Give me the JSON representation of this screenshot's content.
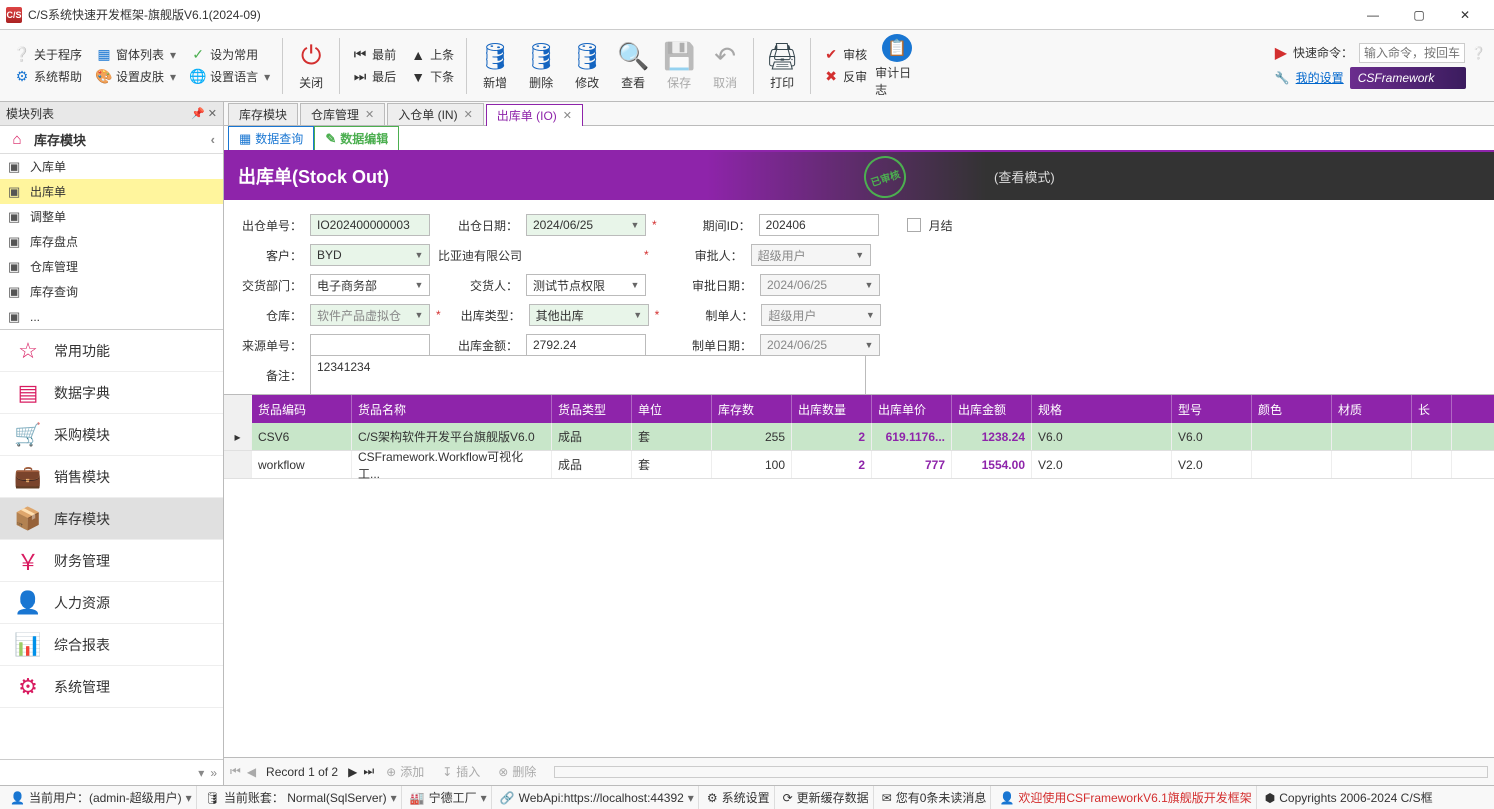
{
  "window": {
    "title": "C/S系统快速开发框架-旗舰版V6.1(2024-09)"
  },
  "ribbon": {
    "about": "关于程序",
    "formlist": "窗体列表",
    "setdefault": "设为常用",
    "syshelp": "系统帮助",
    "skin": "设置皮肤",
    "lang": "设置语言",
    "close": "关闭",
    "first": "最前",
    "last": "最后",
    "prev": "上条",
    "next": "下条",
    "add": "新增",
    "delete": "删除",
    "edit": "修改",
    "view": "查看",
    "save": "保存",
    "cancel": "取消",
    "print": "打印",
    "approve": "审核",
    "reject": "反审",
    "auditlog": "审计日志",
    "quickcmd": "快速命令：",
    "cmdplaceholder": "输入命令，按回车",
    "mysettings": "我的设置",
    "logo": "CSFramework"
  },
  "sidebarHeader": "模块列表",
  "sidebarSection": "库存模块",
  "tree": [
    {
      "label": "入库单"
    },
    {
      "label": "出库单",
      "sel": true
    },
    {
      "label": "调整单"
    },
    {
      "label": "库存盘点"
    },
    {
      "label": "仓库管理"
    },
    {
      "label": "库存查询"
    },
    {
      "label": "..."
    }
  ],
  "modules": [
    {
      "label": "常用功能",
      "icon": "☆"
    },
    {
      "label": "数据字典",
      "icon": "▤"
    },
    {
      "label": "采购模块",
      "icon": "🛒"
    },
    {
      "label": "销售模块",
      "icon": "💼"
    },
    {
      "label": "库存模块",
      "icon": "📦",
      "active": true
    },
    {
      "label": "财务管理",
      "icon": "￥"
    },
    {
      "label": "人力资源",
      "icon": "👤"
    },
    {
      "label": "综合报表",
      "icon": "📊"
    },
    {
      "label": "系统管理",
      "icon": "⚙"
    }
  ],
  "tabs": [
    {
      "label": "库存模块"
    },
    {
      "label": "仓库管理",
      "x": true
    },
    {
      "label": "入仓单 (IN)",
      "x": true
    },
    {
      "label": "出库单 (IO)",
      "x": true,
      "active": true
    }
  ],
  "subtabs": {
    "query": "数据查询",
    "edit": "数据编辑"
  },
  "doc": {
    "title": "出库单(Stock Out)",
    "stamp": "已审核",
    "mode": "(查看模式)"
  },
  "form": {
    "l_outno": "出仓单号：",
    "outno": "IO202400000003",
    "l_outdate": "出仓日期：",
    "outdate": "2024/06/25",
    "l_period": "期间ID：",
    "period": "202406",
    "l_monthclose": "月结",
    "l_customer": "客户：",
    "customer": "BYD",
    "customer_name": "比亚迪有限公司",
    "l_approver": "审批人：",
    "approver": "超级用户",
    "l_dept": "交货部门：",
    "dept": "电子商务部",
    "l_deliverer": "交货人：",
    "deliverer": "测试节点权限",
    "l_approvedate": "审批日期：",
    "approvedate": "2024/06/25",
    "l_warehouse": "仓库：",
    "warehouse": "软件产品虚拟仓",
    "l_outtype": "出库类型：",
    "outtype": "其他出库",
    "l_creator": "制单人：",
    "creator": "超级用户",
    "l_srcno": "来源单号：",
    "srcno": "",
    "l_amount": "出库金额：",
    "amount": "2792.24",
    "l_createdate": "制单日期：",
    "createdate": "2024/06/25",
    "l_remark": "备注：",
    "remark": "12341234"
  },
  "gridcols": [
    "货品编码",
    "货品名称",
    "货品类型",
    "单位",
    "库存数",
    "出库数量",
    "出库单价",
    "出库金额",
    "规格",
    "型号",
    "颜色",
    "材质",
    "长"
  ],
  "gridrows": [
    {
      "code": "CSV6",
      "name": "C/S架构软件开发平台旗舰版V6.0",
      "type": "成品",
      "unit": "套",
      "stock": "255",
      "qty": "2",
      "price": "619.1176...",
      "amount": "1238.24",
      "spec": "V6.0",
      "model": "V6.0",
      "hl": true
    },
    {
      "code": "workflow",
      "name": "CSFramework.Workflow可视化工...",
      "type": "成品",
      "unit": "套",
      "stock": "100",
      "qty": "2",
      "price": "777",
      "amount": "1554.00",
      "spec": "V2.0",
      "model": "V2.0"
    }
  ],
  "gridfoot": {
    "record": "Record 1 of 2",
    "add": "添加",
    "insert": "插入",
    "delete": "删除"
  },
  "status": {
    "user": "当前用户：(admin-超级用户)",
    "account": "当前账套： Normal(SqlServer)",
    "factory": "宁德工厂",
    "webapi": "WebApi:https://localhost:44392",
    "settings": "系统设置",
    "cache": "更新缓存数据",
    "msg": "您有0条未读消息",
    "welcome": "欢迎使用CSFrameworkV6.1旗舰版开发框架",
    "copyright": "Copyrights 2006-2024 C/S框"
  }
}
